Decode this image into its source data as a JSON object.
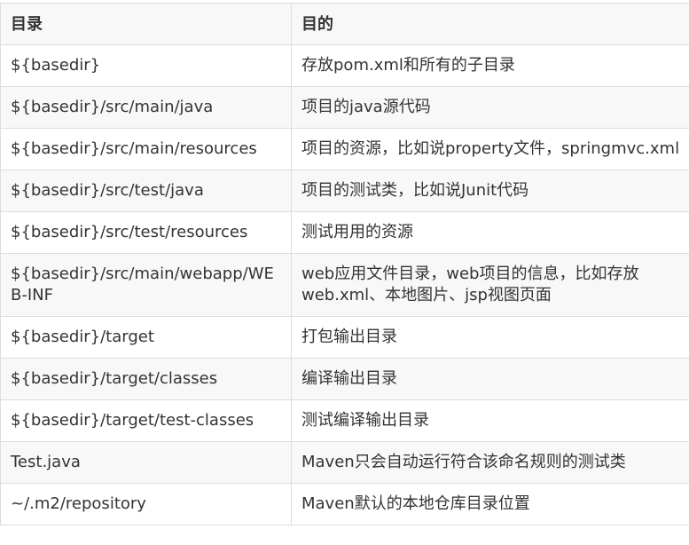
{
  "table": {
    "headers": [
      "目录",
      "目的"
    ],
    "rows": [
      {
        "dir": "${basedir}",
        "purpose": "存放pom.xml和所有的子目录"
      },
      {
        "dir": "${basedir}/src/main/java",
        "purpose": "项目的java源代码"
      },
      {
        "dir": "${basedir}/src/main/resources",
        "purpose": "项目的资源，比如说property文件，springmvc.xml"
      },
      {
        "dir": "${basedir}/src/test/java",
        "purpose": "项目的测试类，比如说Junit代码"
      },
      {
        "dir": "${basedir}/src/test/resources",
        "purpose": "测试用用的资源"
      },
      {
        "dir": "${basedir}/src/main/webapp/WEB-INF",
        "purpose": "web应用文件目录，web项目的信息，比如存放web.xml、本地图片、jsp视图页面"
      },
      {
        "dir": "${basedir}/target",
        "purpose": "打包输出目录"
      },
      {
        "dir": "${basedir}/target/classes",
        "purpose": "编译输出目录"
      },
      {
        "dir": "${basedir}/target/test-classes",
        "purpose": "测试编译输出目录"
      },
      {
        "dir": "Test.java",
        "purpose": "Maven只会自动运行符合该命名规则的测试类"
      },
      {
        "dir": "~/.m2/repository",
        "purpose": "Maven默认的本地仓库目录位置"
      }
    ]
  }
}
